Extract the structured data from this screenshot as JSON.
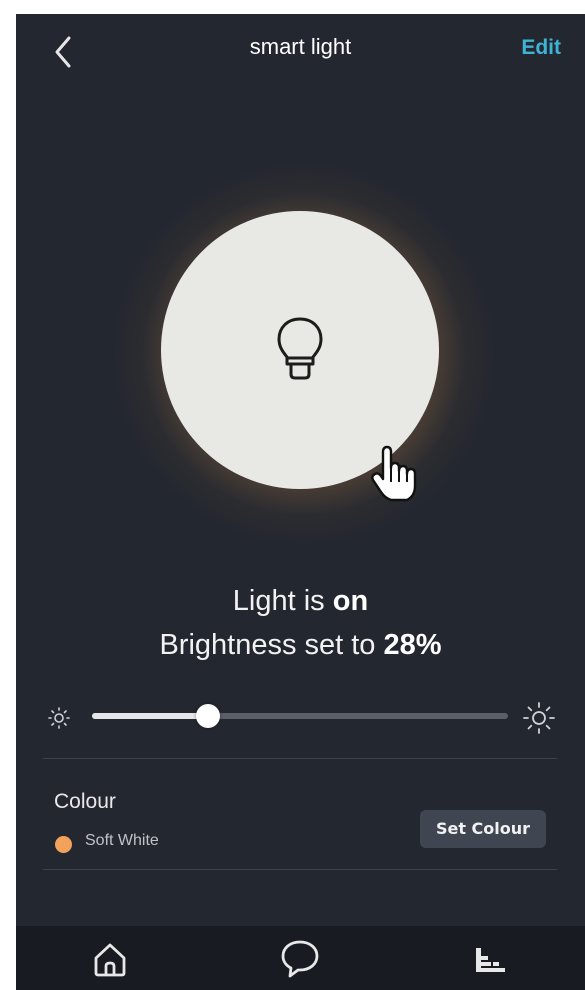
{
  "header": {
    "back_icon": "chevron-left-icon",
    "title": "smart light",
    "edit_label": "Edit"
  },
  "colors": {
    "background": "#232730",
    "accent": "#3fb3d6",
    "light_circle": "#e8e8e5",
    "glow": "#b07d46",
    "colour_dot": "#f2a25a",
    "navbar": "#181b22"
  },
  "light": {
    "power_icon": "lightbulb-icon",
    "cursor_icon": "hand-pointer-icon",
    "status_prefix": "Light is ",
    "status_state": "on",
    "brightness_prefix": "Brightness set to ",
    "brightness_value": "28%"
  },
  "brightness_slider": {
    "value_fraction": 0.28,
    "min_icon": "sun-small-icon",
    "max_icon": "sun-large-icon"
  },
  "colour": {
    "label": "Colour",
    "current_value": "Soft White",
    "set_button_label": "Set Colour"
  },
  "navbar": {
    "items": [
      {
        "icon": "home-icon"
      },
      {
        "icon": "chat-icon"
      },
      {
        "icon": "devices-icon"
      }
    ]
  }
}
